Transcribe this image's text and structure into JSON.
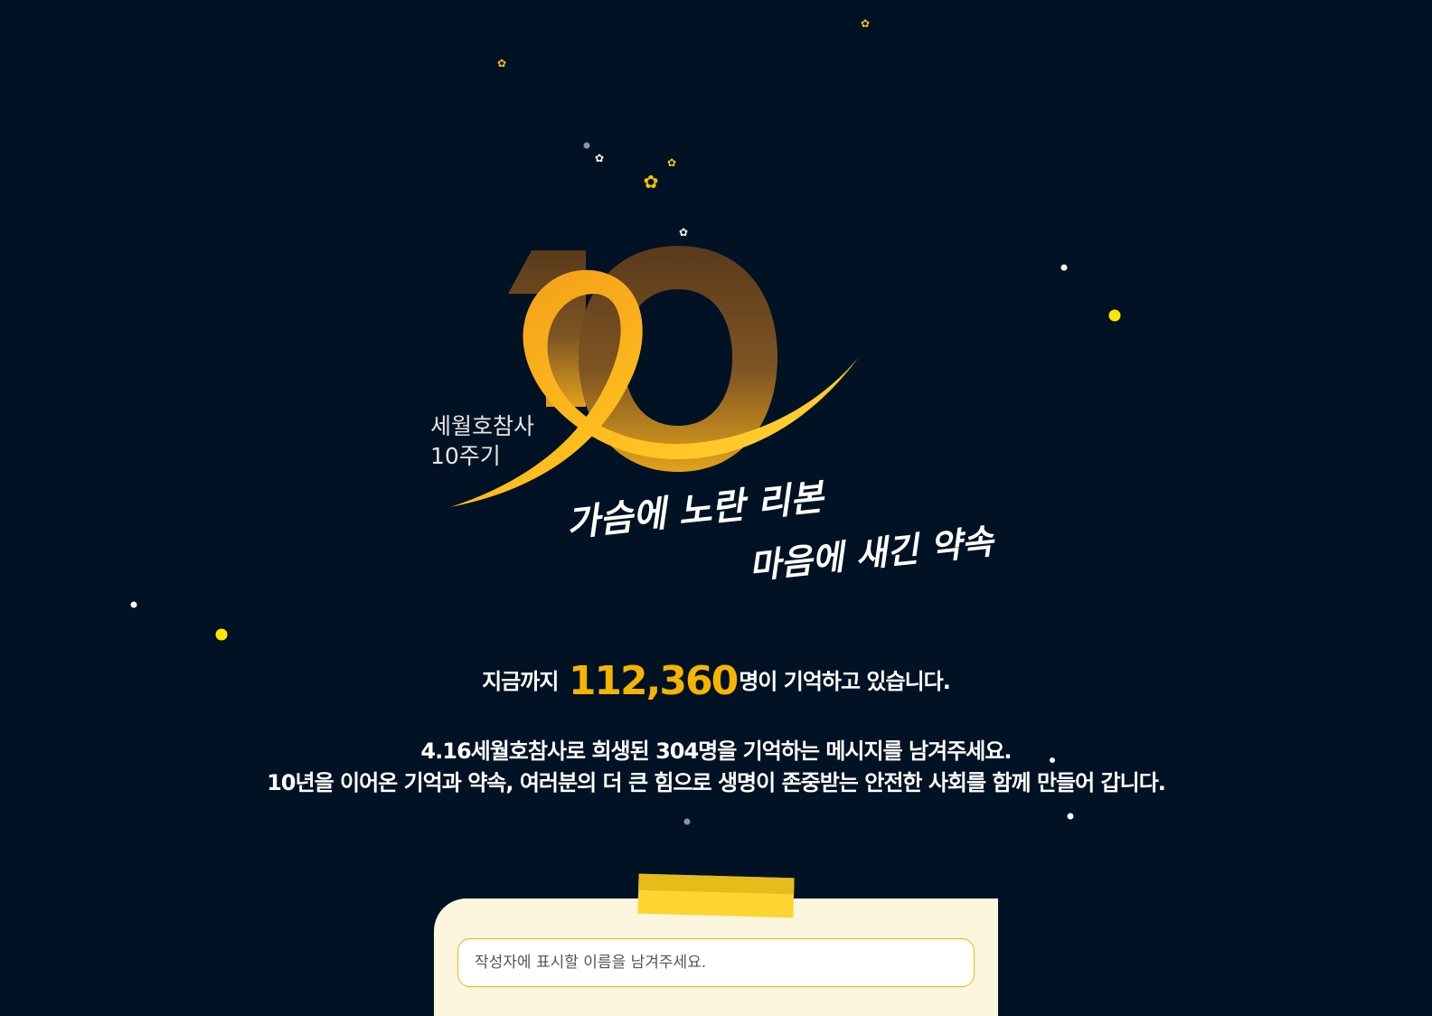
{
  "logo": {
    "number": "10",
    "caption_line1": "세월호참사",
    "caption_line2": "10주기",
    "slogan_line1": "가슴에 노란 리본",
    "slogan_line2": "마음에 새긴 약속"
  },
  "counter": {
    "prefix": "지금까지",
    "count": "112,360",
    "suffix": "명이 기억하고 있습니다."
  },
  "intro": {
    "line1": "4.16세월호참사로 희생된 304명을 기억하는 메시지를 남겨주세요.",
    "line2": "10년을 이어온 기억과 약속, 여러분의 더 큰 힘으로 생명이 존중받는 안전한 사회를 함께 만들어 갑니다."
  },
  "form": {
    "name_placeholder": "작성자에 표시할 이름을 남겨주세요."
  },
  "colors": {
    "background": "#001224",
    "accent": "#f5b400",
    "card": "#fdf6de",
    "ribbon": "#ffd233"
  }
}
